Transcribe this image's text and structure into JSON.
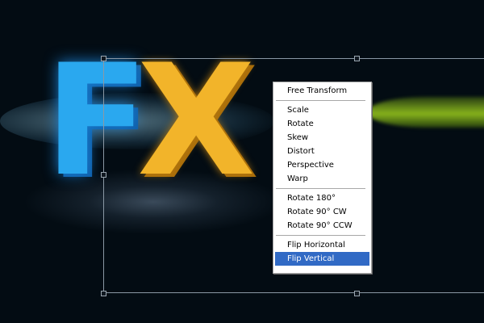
{
  "canvas": {
    "letters": [
      "F",
      "X"
    ]
  },
  "context_menu": {
    "groups": [
      [
        "Free Transform"
      ],
      [
        "Scale",
        "Rotate",
        "Skew",
        "Distort",
        "Perspective",
        "Warp"
      ],
      [
        "Rotate 180°",
        "Rotate 90° CW",
        "Rotate 90° CCW"
      ],
      [
        "Flip Horizontal",
        "Flip Vertical"
      ]
    ],
    "selected": "Flip Vertical",
    "highlight_color": "#316ac5"
  }
}
